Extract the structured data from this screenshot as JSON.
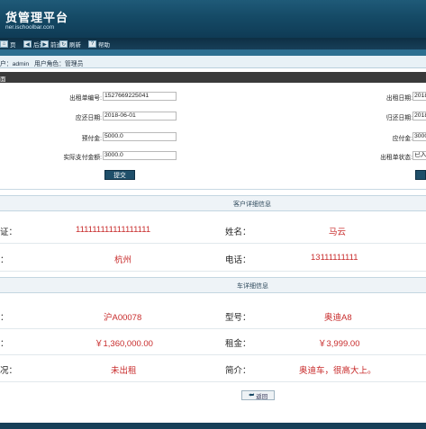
{
  "header": {
    "title": "货管理平台",
    "url": "ner.ischoolbar.com"
  },
  "toolbar": {
    "items": [
      {
        "icon": "home-icon",
        "label": "页"
      },
      {
        "icon": "back-icon",
        "label": "后退"
      },
      {
        "icon": "forward-icon",
        "label": "前进"
      },
      {
        "icon": "refresh-icon",
        "label": "刷新"
      },
      {
        "icon": "help-icon",
        "label": "帮助"
      }
    ]
  },
  "userbar": {
    "text": "户：admin",
    "role": "用户角色：管理员"
  },
  "form": {
    "section_title": "面",
    "order_no_label": "出租单编号:",
    "order_no_value": "1527669225041",
    "order_date_label": "出租日期:",
    "order_date_value": "2018",
    "due_date_label": "应还日期:",
    "due_date_value": "2018-06-01",
    "return_date_label": "归还日期:",
    "return_date_value": "2018",
    "deposit_label": "预付金:",
    "deposit_value": "5000.0",
    "payable_label": "应付金:",
    "payable_value": "3000",
    "paid_label": "实际支付金额:",
    "paid_value": "3000.0",
    "status_label": "出租单状态:",
    "status_value": "已入",
    "submit_label": "提交"
  },
  "customer": {
    "title": "客户详细信息",
    "id_label": "证：",
    "id_value": "111111111111111111",
    "name_label": "姓名：",
    "name_value": "马云",
    "addr_label": "：",
    "addr_value": "杭州",
    "phone_label": "电话：",
    "phone_value": "13111111111"
  },
  "car": {
    "title": "车详细信息",
    "plate_label": "：",
    "plate_value": "沪A00078",
    "model_label": "型号：",
    "model_value": "奥迪A8",
    "price_label": "：",
    "price_value": "￥1,360,000.00",
    "rent_label": "租金：",
    "rent_value": "￥3,999.00",
    "status_label": "况：",
    "status_value": "未出租",
    "desc_label": "简介：",
    "desc_value": "奥迪车，很高大上。"
  },
  "back_label": "返回"
}
